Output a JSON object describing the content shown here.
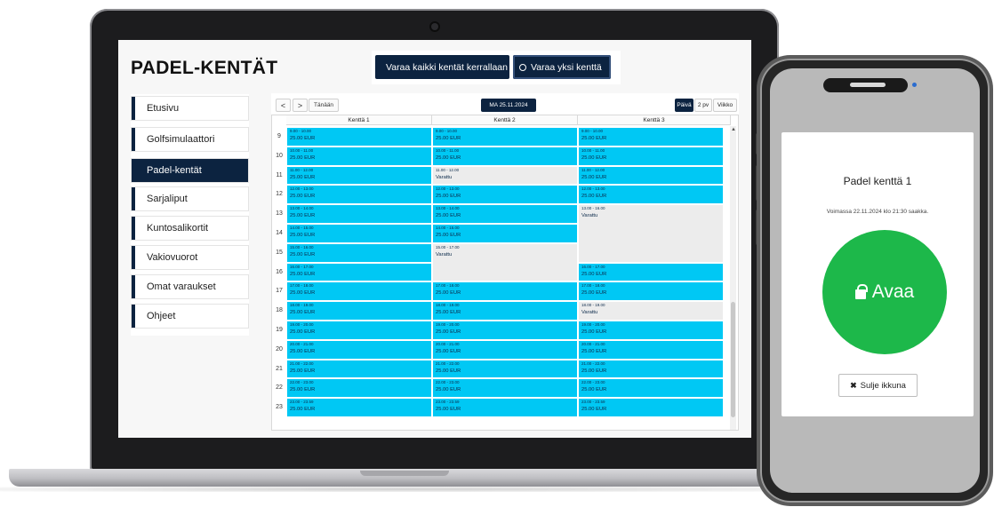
{
  "app": {
    "title": "PADEL-KENTÄT"
  },
  "mode_buttons": [
    {
      "label": "Varaa kaikki kentät kerrallaan",
      "selected": true
    },
    {
      "label": "Varaa yksi kenttä",
      "selected": false
    }
  ],
  "sidebar": {
    "items": [
      {
        "label": "Etusivu",
        "active": false
      },
      {
        "label": "Golfsimulaattori",
        "active": false
      },
      {
        "label": "Padel-kentät",
        "active": true
      },
      {
        "label": "Sarjaliput",
        "active": false
      },
      {
        "label": "Kuntosalikortit",
        "active": false
      },
      {
        "label": "Vakiovuorot",
        "active": false
      },
      {
        "label": "Omat varaukset",
        "active": false
      },
      {
        "label": "Ohjeet",
        "active": false
      }
    ]
  },
  "calendar": {
    "prev": "<",
    "next": ">",
    "today": "Tänään",
    "date": "MA 25.11.2024",
    "views": [
      {
        "label": "Päivä",
        "active": true
      },
      {
        "label": "2 pv",
        "active": false
      },
      {
        "label": "Viikko",
        "active": false
      }
    ],
    "columns": [
      "Kenttä 1",
      "Kenttä 2",
      "Kenttä 3"
    ],
    "hours": [
      "9",
      "10",
      "11",
      "12",
      "13",
      "14",
      "15",
      "16",
      "17",
      "18",
      "19",
      "20",
      "21",
      "22",
      "23"
    ],
    "courts": [
      [
        {
          "time": "9.00 - 10.00",
          "text": "25.00 EUR",
          "busy": false
        },
        {
          "time": "10.00 - 11.00",
          "text": "25.00 EUR",
          "busy": false
        },
        {
          "time": "11.00 - 12.00",
          "text": "25.00 EUR",
          "busy": false
        },
        {
          "time": "12.00 - 13.00",
          "text": "25.00 EUR",
          "busy": false
        },
        {
          "time": "13.00 - 14.00",
          "text": "25.00 EUR",
          "busy": false
        },
        {
          "time": "14.00 - 15.00",
          "text": "25.00 EUR",
          "busy": false
        },
        {
          "time": "15.00 - 16.00",
          "text": "25.00 EUR",
          "busy": false
        },
        {
          "time": "16.00 - 17.00",
          "text": "25.00 EUR",
          "busy": false
        },
        {
          "time": "17.00 - 18.00",
          "text": "25.00 EUR",
          "busy": false
        },
        {
          "time": "18.00 - 19.00",
          "text": "25.00 EUR",
          "busy": false
        },
        {
          "time": "19.00 - 20.00",
          "text": "25.00 EUR",
          "busy": false
        },
        {
          "time": "20.00 - 21.00",
          "text": "25.00 EUR",
          "busy": false
        },
        {
          "time": "21.00 - 22.00",
          "text": "25.00 EUR",
          "busy": false
        },
        {
          "time": "22.00 - 23.00",
          "text": "25.00 EUR",
          "busy": false
        },
        {
          "time": "23.00 - 23.59",
          "text": "25.00 EUR",
          "busy": false
        }
      ],
      [
        {
          "time": "9.00 - 10.00",
          "text": "25.00 EUR",
          "busy": false
        },
        {
          "time": "10.00 - 11.00",
          "text": "25.00 EUR",
          "busy": false
        },
        {
          "time": "11.00 - 12.00",
          "text": "Varattu",
          "busy": true
        },
        {
          "time": "12.00 - 13.00",
          "text": "25.00 EUR",
          "busy": false
        },
        {
          "time": "13.00 - 14.00",
          "text": "25.00 EUR",
          "busy": false
        },
        {
          "time": "14.00 - 15.00",
          "text": "25.00 EUR",
          "busy": false
        },
        {
          "time": "15.00 - 17.00",
          "text": "Varattu",
          "busy": true,
          "span": 2
        },
        {
          "time": "17.00 - 18.00",
          "text": "25.00 EUR",
          "busy": false
        },
        {
          "time": "18.00 - 19.00",
          "text": "25.00 EUR",
          "busy": false
        },
        {
          "time": "19.00 - 20.00",
          "text": "25.00 EUR",
          "busy": false
        },
        {
          "time": "20.00 - 21.00",
          "text": "25.00 EUR",
          "busy": false
        },
        {
          "time": "21.00 - 22.00",
          "text": "25.00 EUR",
          "busy": false
        },
        {
          "time": "22.00 - 23.00",
          "text": "25.00 EUR",
          "busy": false
        },
        {
          "time": "23.00 - 23.59",
          "text": "25.00 EUR",
          "busy": false
        }
      ],
      [
        {
          "time": "9.00 - 10.00",
          "text": "25.00 EUR",
          "busy": false
        },
        {
          "time": "10.00 - 11.00",
          "text": "25.00 EUR",
          "busy": false
        },
        {
          "time": "11.00 - 12.00",
          "text": "25.00 EUR",
          "busy": false
        },
        {
          "time": "12.00 - 13.00",
          "text": "25.00 EUR",
          "busy": false
        },
        {
          "time": "13.00 - 16.00",
          "text": "Varattu",
          "busy": true,
          "span": 3
        },
        {
          "time": "16.00 - 17.00",
          "text": "25.00 EUR",
          "busy": false
        },
        {
          "time": "17.00 - 18.00",
          "text": "25.00 EUR",
          "busy": false
        },
        {
          "time": "18.00 - 19.00",
          "text": "Varattu",
          "busy": true
        },
        {
          "time": "19.00 - 20.00",
          "text": "25.00 EUR",
          "busy": false
        },
        {
          "time": "20.00 - 21.00",
          "text": "25.00 EUR",
          "busy": false
        },
        {
          "time": "21.00 - 22.00",
          "text": "25.00 EUR",
          "busy": false
        },
        {
          "time": "22.00 - 23.00",
          "text": "25.00 EUR",
          "busy": false
        },
        {
          "time": "23.00 - 23.59",
          "text": "25.00 EUR",
          "busy": false
        }
      ]
    ]
  },
  "phone": {
    "title": "Padel kenttä 1",
    "validity": "Voimassa 22.11.2024 klo 21:30 saakka.",
    "open_label": "Avaa",
    "open_icon": "lock-icon",
    "close_label": "Sulje ikkuna",
    "close_icon": "close-icon"
  },
  "colors": {
    "navy": "#0c2340",
    "slot": "#00c8f4",
    "slot_busy": "#ececec",
    "open": "#1db84a"
  }
}
